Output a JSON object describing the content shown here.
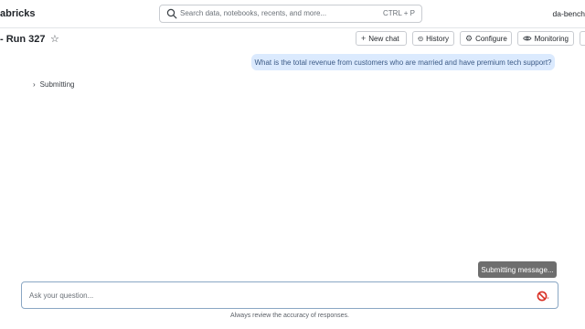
{
  "header": {
    "logo_text": "abricks",
    "search_placeholder": "Search data, notebooks, recents, and more...",
    "search_shortcut": "CTRL + P",
    "user": "da-bench"
  },
  "page": {
    "title": "- Run 327",
    "star_icon": "★",
    "actions": {
      "new_chat": "New chat",
      "history": "History",
      "configure": "Configure",
      "monitoring": "Monitoring"
    }
  },
  "chat": {
    "user_message": "What is the total revenue from customers who are married and have premium tech support?",
    "status_chevron": "›",
    "status_text": "Submitting"
  },
  "composer": {
    "placeholder": "Ask your question...",
    "tooltip": "Submitting message...",
    "disclaimer": "Always review the accuracy of responses."
  },
  "colors": {
    "accent": "#dbeafe",
    "stop_icon": "#d93025"
  }
}
